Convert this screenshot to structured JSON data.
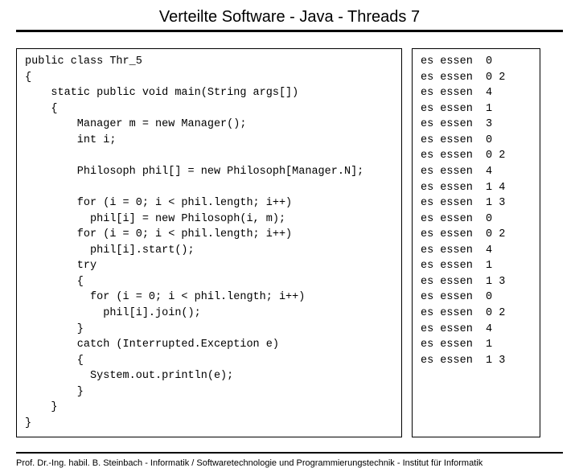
{
  "title": "Verteilte Software - Java - Threads 7",
  "code": "public class Thr_5\n{\n    static public void main(String args[])\n    {\n        Manager m = new Manager();\n        int i;\n\n        Philosoph phil[] = new Philosoph[Manager.N];\n\n        for (i = 0; i < phil.length; i++)\n          phil[i] = new Philosoph(i, m);\n        for (i = 0; i < phil.length; i++)\n          phil[i].start();\n        try\n        {\n          for (i = 0; i < phil.length; i++)\n            phil[i].join();\n        }\n        catch (Interrupted.Exception e)\n        {\n          System.out.println(e);\n        }\n    }\n}",
  "output_rows": [
    [
      "es essen",
      "0"
    ],
    [
      "es essen",
      "0 2"
    ],
    [
      "es essen",
      "4"
    ],
    [
      "es essen",
      "1"
    ],
    [
      "es essen",
      "3"
    ],
    [
      "es essen",
      "0"
    ],
    [
      "es essen",
      "0 2"
    ],
    [
      "es essen",
      "4"
    ],
    [
      "es essen",
      "1 4"
    ],
    [
      "es essen",
      "1 3"
    ],
    [
      "es essen",
      "0"
    ],
    [
      "es essen",
      "0 2"
    ],
    [
      "es essen",
      "4"
    ],
    [
      "es essen",
      "1"
    ],
    [
      "es essen",
      "1 3"
    ],
    [
      "es essen",
      "0"
    ],
    [
      "es essen",
      "0 2"
    ],
    [
      "es essen",
      "4"
    ],
    [
      "es essen",
      "1"
    ],
    [
      "es essen",
      "1 3"
    ]
  ],
  "footer": "Prof. Dr.-Ing. habil. B. Steinbach - Informatik / Softwaretechnologie und Programmierungstechnik - Institut für Informatik"
}
